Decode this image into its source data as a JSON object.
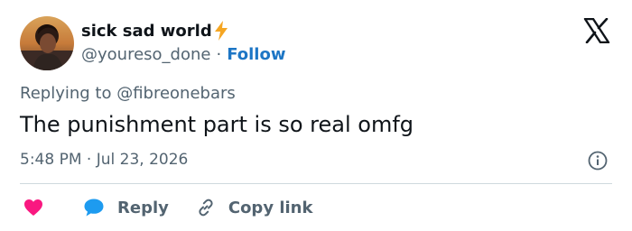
{
  "user": {
    "display_name": "sick sad world",
    "handle": "@youreso_done",
    "follow_label": "Follow",
    "separator": "·"
  },
  "reply_context": {
    "prefix": "Replying to ",
    "mention": "@fibreonebars"
  },
  "tweet": {
    "text": "The punishment part is so real omfg",
    "timestamp": "5:48 PM · Jul 23, 2026"
  },
  "actions": {
    "reply_label": "Reply",
    "copy_link_label": "Copy link"
  },
  "colors": {
    "follow": "#1d76c5",
    "heart": "#f91880",
    "reply_bubble": "#1d9bf0",
    "bolt": "#f5a623",
    "muted_text": "#536471",
    "primary_text": "#0f1419"
  },
  "icons": [
    "lightning-bolt-icon",
    "x-logo-icon",
    "info-icon",
    "heart-icon",
    "reply-bubble-icon",
    "link-icon"
  ]
}
